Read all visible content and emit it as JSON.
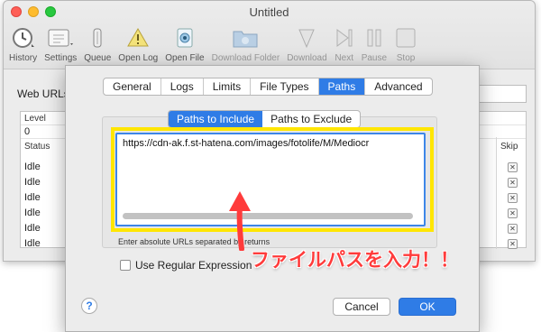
{
  "window": {
    "title": "Untitled"
  },
  "toolbar": {
    "items": [
      {
        "label": "History",
        "icon": "clock-icon"
      },
      {
        "label": "Settings",
        "icon": "settings-icon"
      },
      {
        "label": "Queue",
        "icon": "queue-icon"
      },
      {
        "label": "Open Log",
        "icon": "warning-icon"
      },
      {
        "label": "Open File",
        "icon": "eye-icon"
      },
      {
        "label": "Download Folder",
        "icon": "folder-icon"
      },
      {
        "label": "Download",
        "icon": "download-icon"
      },
      {
        "label": "Next",
        "icon": "next-icon"
      },
      {
        "label": "Pause",
        "icon": "pause-icon"
      },
      {
        "label": "Stop",
        "icon": "stop-icon"
      }
    ]
  },
  "main": {
    "web_urls_label": "Web URLs",
    "level_label": "Level",
    "level_value": "0",
    "status_header": "Status",
    "skip_header": "Skip",
    "rows": [
      "Idle",
      "Idle",
      "Idle",
      "Idle",
      "Idle",
      "Idle"
    ]
  },
  "sheet": {
    "tabs": [
      "General",
      "Logs",
      "Limits",
      "File Types",
      "Paths",
      "Advanced"
    ],
    "active_tab": "Paths",
    "segments": [
      "Paths to Include",
      "Paths to Exclude"
    ],
    "active_segment": "Paths to Include",
    "path_text": "https://cdn-ak.f.st-hatena.com/images/fotolife/M/Mediocr",
    "hint": "Enter absolute URLs separated by returns",
    "regex_label": "Use Regular Expression",
    "regex_checked": false,
    "help_label": "?",
    "cancel_label": "Cancel",
    "ok_label": "OK"
  },
  "annotation": {
    "text": "ファイルパスを入力！！",
    "color": "#ff3b3b"
  },
  "colors": {
    "accent": "#2f7ce6",
    "highlight": "#ffe600"
  }
}
